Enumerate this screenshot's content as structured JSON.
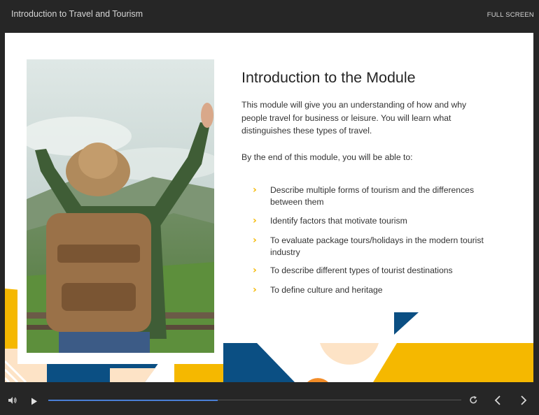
{
  "header": {
    "title": "Introduction to Travel and Tourism",
    "fullscreen_label": "FULL SCREEN"
  },
  "slide": {
    "heading": "Introduction to the Module",
    "intro": "This module will give you an understanding of how and why people travel for business or leisure. You will learn what distinguishes these types of travel.",
    "lead": "By the end of this module, you will be able to:",
    "objectives": [
      "Describe multiple forms of tourism and the differences between them",
      "Identify factors that motivate tourism",
      "To evaluate package tours/holidays in the modern tourist industry",
      "To describe different types of tourist destinations",
      "To define culture and heritage"
    ],
    "bullet_glyph": "›"
  },
  "colors": {
    "accent_yellow": "#f5b800",
    "accent_blue": "#0b4f83",
    "peach": "#fde3c6",
    "progress": "#4a7fd6",
    "chrome": "#262626"
  },
  "player": {
    "progress_fraction": 0.41,
    "icons": [
      "volume-icon",
      "play-icon",
      "replay-icon",
      "prev-arrow-icon",
      "next-arrow-icon"
    ]
  }
}
